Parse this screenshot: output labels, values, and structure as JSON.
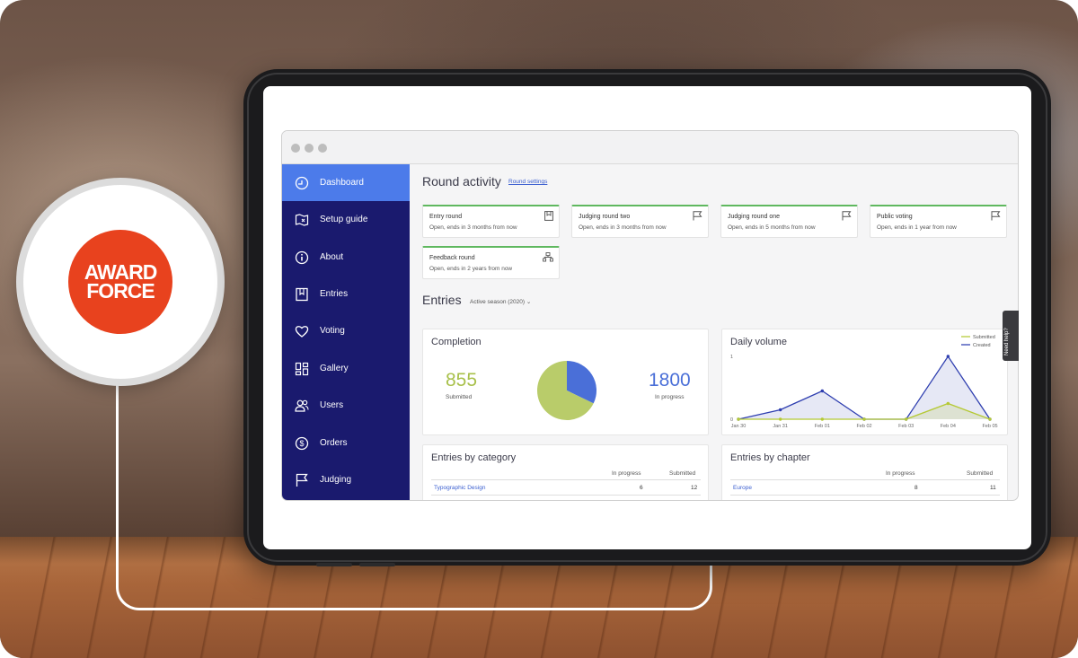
{
  "brand": {
    "logo_line1": "AWARD",
    "logo_line2": "FORCE",
    "logo_color": "#e8421e"
  },
  "sidebar": {
    "background": "#1a1a6e",
    "active_color": "#4c7bea",
    "items": [
      {
        "label": "Dashboard",
        "icon": "dashboard-gauge-icon",
        "active": true
      },
      {
        "label": "Setup guide",
        "icon": "map-icon",
        "active": false
      },
      {
        "label": "About",
        "icon": "info-icon",
        "active": false
      },
      {
        "label": "Entries",
        "icon": "bookmark-icon",
        "active": false
      },
      {
        "label": "Voting",
        "icon": "heart-icon",
        "active": false
      },
      {
        "label": "Gallery",
        "icon": "gallery-grid-icon",
        "active": false
      },
      {
        "label": "Users",
        "icon": "users-icon",
        "active": false
      },
      {
        "label": "Orders",
        "icon": "dollar-icon",
        "active": false
      },
      {
        "label": "Judging",
        "icon": "flag-icon",
        "active": false
      }
    ]
  },
  "round_activity": {
    "title": "Round activity",
    "settings_link": "Round settings",
    "rounds": [
      {
        "name": "Entry round",
        "status": "Open, ends in 3 months from now",
        "icon": "bookmark-icon"
      },
      {
        "name": "Judging round two",
        "status": "Open, ends in 3 months from now",
        "icon": "flag-icon"
      },
      {
        "name": "Judging round one",
        "status": "Open, ends in 5 months from now",
        "icon": "flag-icon"
      },
      {
        "name": "Public voting",
        "status": "Open, ends in 1 year from now",
        "icon": "flag-icon"
      },
      {
        "name": "Feedback round",
        "status": "Open, ends in 2 years from now",
        "icon": "feedback-icon"
      }
    ]
  },
  "entries": {
    "title": "Entries",
    "season": "Active season (2020)"
  },
  "completion": {
    "title": "Completion",
    "submitted_value": "855",
    "submitted_label": "Submitted",
    "in_progress_value": "1800",
    "in_progress_label": "In progress",
    "submitted_color": "#a8c04a",
    "in_progress_color": "#4a6fd8"
  },
  "chart_data": [
    {
      "type": "pie",
      "title": "Completion",
      "labels": [
        "Submitted",
        "In progress"
      ],
      "values": [
        855,
        1800
      ],
      "colors": [
        "#4a6fd8",
        "#b9cc6a"
      ]
    },
    {
      "type": "line",
      "title": "Daily volume",
      "x": [
        "Jan 30",
        "Jan 31",
        "Feb 01",
        "Feb 02",
        "Feb 03",
        "Feb 04",
        "Feb 05"
      ],
      "ytick_labels": [
        "0",
        "1"
      ],
      "ylim": [
        0,
        1
      ],
      "legend_position": "top-right",
      "series": [
        {
          "name": "Submitted",
          "color": "#b5c935",
          "values": [
            0,
            0,
            0,
            0,
            0,
            0.25,
            0
          ]
        },
        {
          "name": "Created",
          "color": "#2f3fb0",
          "values": [
            0,
            0.15,
            0.45,
            0,
            0,
            1,
            0
          ]
        }
      ]
    }
  ],
  "by_category": {
    "title": "Entries by category",
    "col_in_progress": "In progress",
    "col_submitted": "Submitted",
    "rows": [
      {
        "name": "Typographic Design",
        "in_progress": "6",
        "submitted": "12"
      }
    ]
  },
  "by_chapter": {
    "title": "Entries by chapter",
    "col_in_progress": "In progress",
    "col_submitted": "Submitted",
    "rows": [
      {
        "name": "Europe",
        "in_progress": "8",
        "submitted": "11"
      }
    ]
  },
  "help_tab": "Need help?"
}
